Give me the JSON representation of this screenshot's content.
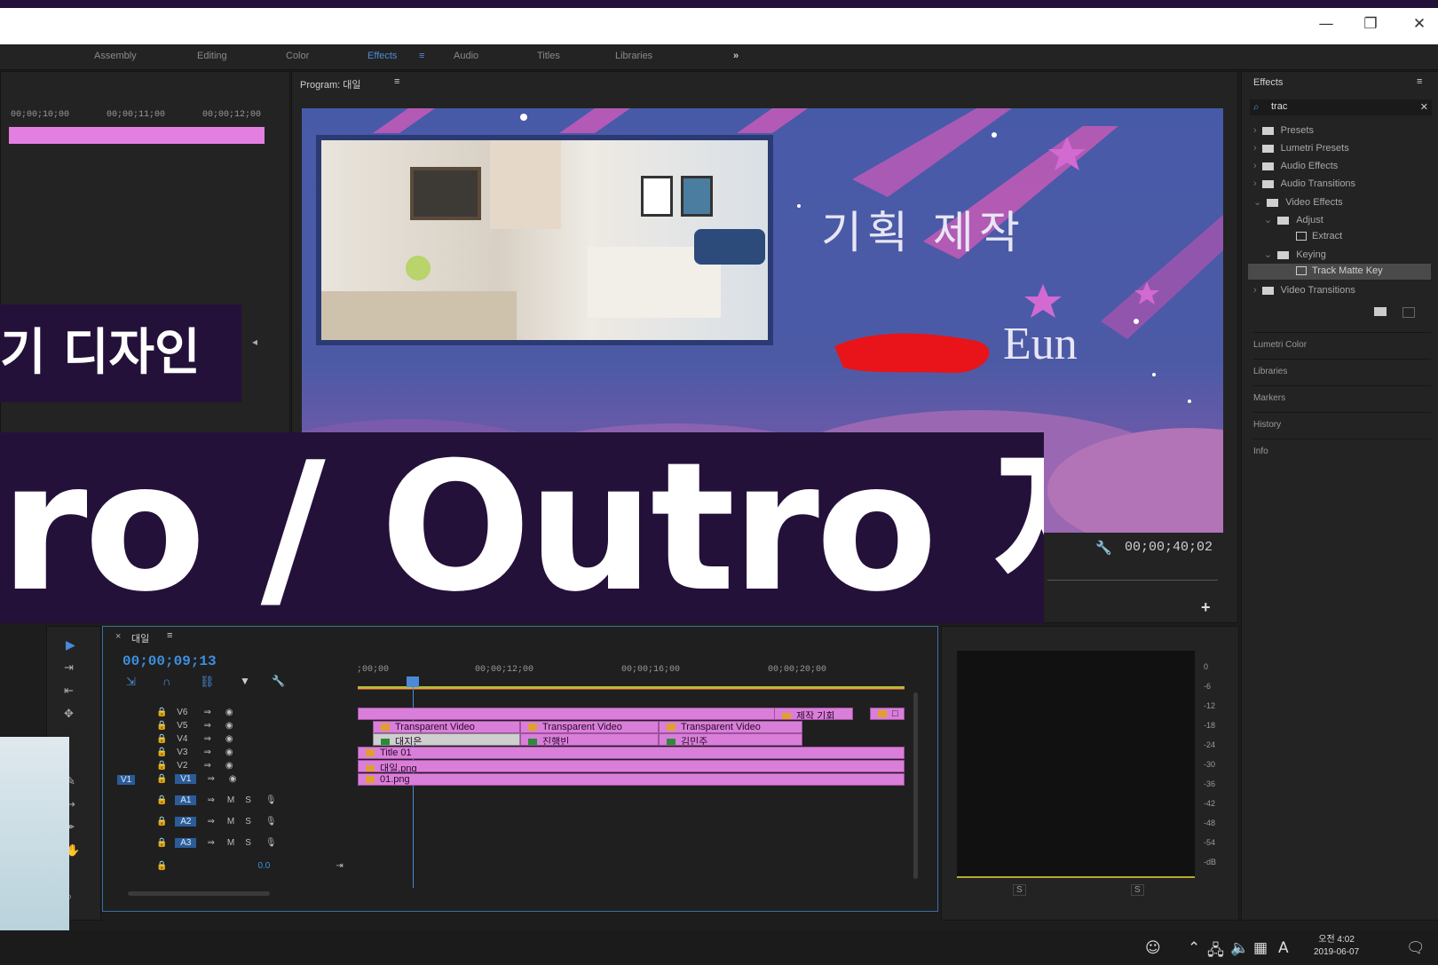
{
  "window": {
    "minimize": "—",
    "restore": "❐",
    "close": "✕"
  },
  "workspaces": [
    "Assembly",
    "Editing",
    "Color",
    "Effects",
    "Audio",
    "Titles",
    "Libraries"
  ],
  "workspace_active": "Effects",
  "workspace_menu": "≡",
  "workspace_more": "»",
  "source": {
    "ruler": [
      "00;00;10;00",
      "00;00;11;00",
      "00;00;12;00"
    ]
  },
  "program": {
    "title": "Program: 대일",
    "menu": "≡",
    "timecode": "00;00;40;02",
    "frame_text_korean": "기획  제작",
    "frame_text_name": "Eun",
    "add_button": "+"
  },
  "effects_panel": {
    "title": "Effects",
    "menu": "≡",
    "search_value": "trac",
    "clear": "✕",
    "tree": [
      {
        "label": "Presets"
      },
      {
        "label": "Lumetri Presets"
      },
      {
        "label": "Audio Effects"
      },
      {
        "label": "Audio Transitions"
      },
      {
        "label": "Video Effects"
      },
      {
        "label": "Adjust"
      },
      {
        "label": "Extract"
      },
      {
        "label": "Keying"
      },
      {
        "label": "Track Matte Key"
      },
      {
        "label": "Video Transitions"
      }
    ],
    "collapsed_panels": [
      "Lumetri Color",
      "Libraries",
      "Markers",
      "History",
      "Info"
    ]
  },
  "timeline": {
    "sequence": "대일",
    "menu": "≡",
    "timecode": "00;00;09;13",
    "ruler": [
      ";00;00",
      "00;00;12;00",
      "00;00;16;00",
      "00;00;20;00"
    ],
    "video_tracks": [
      "V6",
      "V5",
      "V4",
      "V3",
      "V2",
      "V1"
    ],
    "source_patch": "V1",
    "audio_tracks": [
      "A1",
      "A2",
      "A3"
    ],
    "master_volume": "0.0",
    "clips": {
      "v6_a": "제작 기회",
      "v6_b": "□",
      "v5_1": "Transparent Video",
      "v5_2": "Transparent Video",
      "v5_3": "Transparent Video",
      "v4_1": "대지은",
      "v4_2": "진행빈",
      "v4_3": "김민주",
      "v3": "Title 01",
      "v2": "대일.png",
      "v1": "01.png"
    }
  },
  "meter": {
    "scale": [
      "0",
      "-6",
      "-12",
      "-18",
      "-24",
      "-30",
      "-36",
      "-42",
      "-48",
      "-54",
      "-dB"
    ],
    "solo": [
      "S",
      "S"
    ]
  },
  "overlay": {
    "subtitle": "기 디자인",
    "main": "ro / Outro 제작"
  },
  "taskbar": {
    "time": "오전 4:02",
    "date": "2019-06-07",
    "ime": "A"
  }
}
